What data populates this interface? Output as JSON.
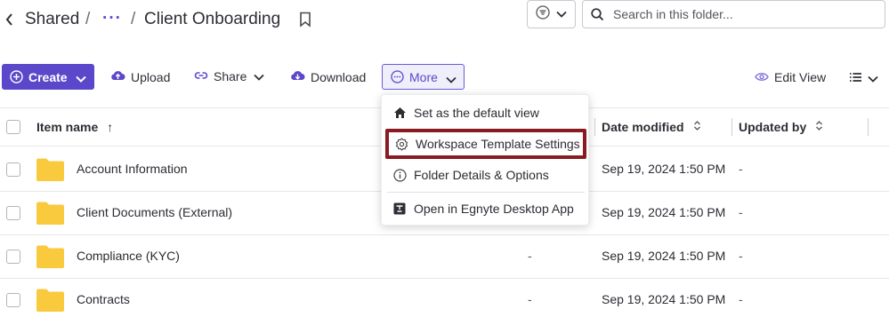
{
  "breadcrumb": {
    "root": "Shared",
    "sep": "/",
    "ellipsis": "···",
    "current": "Client Onboarding"
  },
  "search": {
    "placeholder": "Search in this folder..."
  },
  "toolbar": {
    "create": "Create",
    "upload": "Upload",
    "share": "Share",
    "download": "Download",
    "more": "More",
    "edit_view": "Edit View"
  },
  "table": {
    "headers": {
      "item_name": "Item name",
      "sort_asc_glyph": "↑",
      "date_modified": "Date modified",
      "updated_by": "Updated by"
    },
    "rows": [
      {
        "name": "Account Information",
        "extra": "",
        "date": "Sep 19, 2024 1:50 PM",
        "updated_by": "-"
      },
      {
        "name": "Client Documents (External)",
        "extra": "",
        "date": "Sep 19, 2024 1:50 PM",
        "updated_by": "-"
      },
      {
        "name": "Compliance (KYC)",
        "extra": "-",
        "date": "Sep 19, 2024 1:50 PM",
        "updated_by": "-"
      },
      {
        "name": "Contracts",
        "extra": "-",
        "date": "Sep 19, 2024 1:50 PM",
        "updated_by": "-"
      }
    ]
  },
  "more_menu": {
    "items": [
      {
        "label": "Set as the default view",
        "icon": "home-icon"
      },
      {
        "label": "Workspace Template Settings",
        "icon": "gear-icon",
        "highlighted": true
      },
      {
        "label": "Folder Details & Options",
        "icon": "info-icon"
      },
      {
        "label": "Open in Egnyte Desktop App",
        "icon": "desktop-app-icon"
      }
    ]
  },
  "colors": {
    "accent": "#5b47c9",
    "folder": "#f9c93e",
    "highlight_border": "#8a1a22"
  }
}
